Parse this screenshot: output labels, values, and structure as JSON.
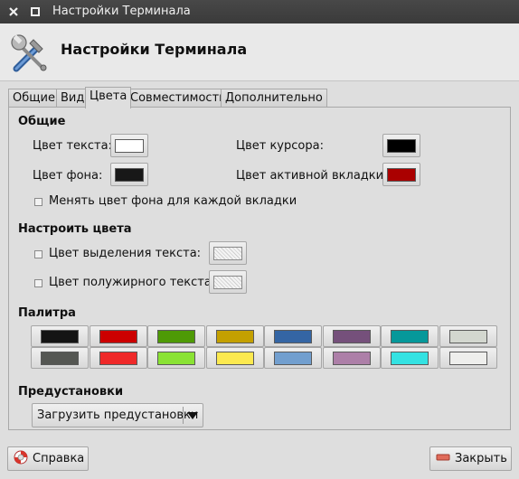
{
  "window": {
    "title": "Настройки Терминала"
  },
  "header": {
    "title": "Настройки Терминала"
  },
  "tabs": [
    {
      "label": "Общие"
    },
    {
      "label": "Вид"
    },
    {
      "label": "Цвета"
    },
    {
      "label": "Совместимость"
    },
    {
      "label": "Дополнительно"
    }
  ],
  "general": {
    "title": "Общие",
    "text_color_label": "Цвет текста:",
    "bg_color_label": "Цвет фона:",
    "cursor_color_label": "Цвет курсора:",
    "active_tab_color_label": "Цвет активной вкладки:",
    "per_tab_bg_label": "Менять цвет фона для каждой вкладки",
    "colors": {
      "text": "#ffffff",
      "background": "#181818",
      "cursor": "#000000",
      "active_tab": "#aa0000"
    }
  },
  "custom": {
    "title": "Настроить цвета",
    "selection_label": "Цвет выделения текста:",
    "bold_label": "Цвет полужирного текста:"
  },
  "palette": {
    "title": "Палитра",
    "row1": [
      "#141414",
      "#cc0000",
      "#4e9a06",
      "#c4a000",
      "#3465a4",
      "#75507b",
      "#06989a",
      "#d3d7cf"
    ],
    "row2": [
      "#555753",
      "#ef2929",
      "#8ae234",
      "#fce94f",
      "#729fcf",
      "#ad7fa8",
      "#34e2e2",
      "#eeeeec"
    ]
  },
  "presets": {
    "title": "Предустановки",
    "dropdown_label": "Загрузить предустановки"
  },
  "footer": {
    "help_label": "Справка",
    "close_label": "Закрыть"
  }
}
